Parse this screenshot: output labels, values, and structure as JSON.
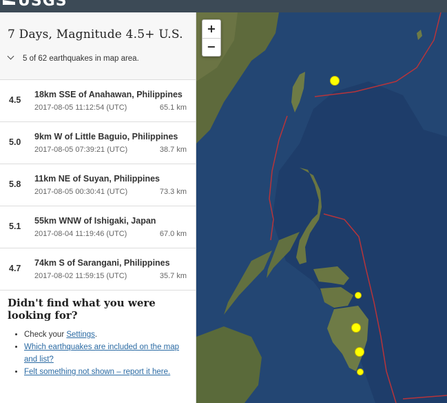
{
  "brand": {
    "logo_text": "USGS"
  },
  "list": {
    "title": "7 Days, Magnitude 4.5+ U.S.",
    "count_text": "5 of 62 earthquakes in map area.",
    "earthquakes": [
      {
        "mag": "4.5",
        "place": "18km SSE of Anahawan, Philippines",
        "time": "2017-08-05 11:12:54 (UTC)",
        "depth": "65.1 km"
      },
      {
        "mag": "5.0",
        "place": "9km W of Little Baguio, Philippines",
        "time": "2017-08-05 07:39:21 (UTC)",
        "depth": "38.7 km"
      },
      {
        "mag": "5.8",
        "place": "11km NE of Suyan, Philippines",
        "time": "2017-08-05 00:30:41 (UTC)",
        "depth": "73.3 km"
      },
      {
        "mag": "5.1",
        "place": "55km WNW of Ishigaki, Japan",
        "time": "2017-08-04 11:19:46 (UTC)",
        "depth": "67.0 km"
      },
      {
        "mag": "4.7",
        "place": "74km S of Sarangani, Philippines",
        "time": "2017-08-02 11:59:15 (UTC)",
        "depth": "35.7 km"
      }
    ]
  },
  "help": {
    "heading": "Didn't find what you were looking for?",
    "item1_prefix": "Check your ",
    "item1_link": "Settings",
    "item1_suffix": ".",
    "item2_link": "Which earthquakes are included on the map and list?",
    "item3_link": "Felt something not shown – report it here."
  },
  "map": {
    "zoom_in": "+",
    "zoom_out": "−",
    "marker_color": "#ffff00",
    "plate_boundary_color": "#c0392b",
    "ocean_color": "#1d3b66",
    "land_color": "#5f6b3a"
  }
}
